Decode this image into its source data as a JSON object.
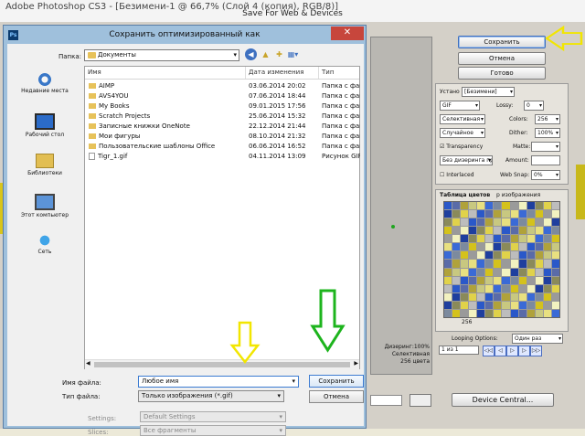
{
  "photoshop": {
    "title": "Adobe Photoshop CS3 - [Безимени-1 @ 66,7% (Слой 4 (копия), RGB/8)]",
    "sfw_title": "Save For Web & Devices"
  },
  "sfw": {
    "save_label": "Сохранить",
    "cancel_label": "Отмена",
    "done_label": "Готово",
    "preset_label": "Устано",
    "preset_value": "[Безимени]",
    "format": "GIF",
    "reduction": "Селективная",
    "dither_algo": "Случайное",
    "lossy_label": "Lossy:",
    "lossy_value": "0",
    "colors_label": "Colors:",
    "colors_value": "256",
    "dither_label": "Dither:",
    "dither_value": "100%",
    "transparency_label": "Transparency",
    "matte_label": "Matte:",
    "transp_dither": "Без дизеринга пр...",
    "amount_label": "Amount:",
    "interlaced_label": "Interlaced",
    "websnap_label": "Web Snap:",
    "websnap_value": "0%",
    "table_tab": "Таблица цветов",
    "image_tab": "р изображения",
    "color_count": "256",
    "looping_label": "Looping Options:",
    "looping_value": "Один раз",
    "frame_label": "1 из 1",
    "device_central": "Device Central...",
    "preview_info": [
      "Дизеринг:100%",
      "Селективная",
      "256 цвета"
    ]
  },
  "dialog": {
    "title": "Сохранить оптимизированный как",
    "folder_label": "Папка:",
    "folder_value": "Документы",
    "places": [
      {
        "label": "Недавние места",
        "icon": "recent-places-icon"
      },
      {
        "label": "Рабочий стол",
        "icon": "desktop-icon"
      },
      {
        "label": "Библиотеки",
        "icon": "libraries-icon"
      },
      {
        "label": "Этот компьютер",
        "icon": "computer-icon"
      },
      {
        "label": "Сеть",
        "icon": "network-icon"
      }
    ],
    "columns": {
      "name": "Имя",
      "date": "Дата изменения",
      "type": "Тип"
    },
    "files": [
      {
        "name": "AIMP",
        "date": "03.06.2014 20:02",
        "type": "Папка с файл",
        "kind": "folder"
      },
      {
        "name": "AVS4YOU",
        "date": "07.06.2014 18:44",
        "type": "Папка с файл",
        "kind": "folder"
      },
      {
        "name": "My Books",
        "date": "09.01.2015 17:56",
        "type": "Папка с файл",
        "kind": "folder"
      },
      {
        "name": "Scratch Projects",
        "date": "25.06.2014 15:32",
        "type": "Папка с файл",
        "kind": "folder"
      },
      {
        "name": "Записные книжки OneNote",
        "date": "22.12.2014 21:44",
        "type": "Папка с файл",
        "kind": "folder"
      },
      {
        "name": "Мои фигуры",
        "date": "08.10.2014 21:32",
        "type": "Папка с файл",
        "kind": "folder"
      },
      {
        "name": "Пользовательские шаблоны Office",
        "date": "06.06.2014 16:52",
        "type": "Папка с файл",
        "kind": "folder"
      },
      {
        "name": "Tigr_1.gif",
        "date": "04.11.2014 13:09",
        "type": "Рисунок GIF",
        "kind": "gif"
      }
    ],
    "filename_label": "Имя файла:",
    "filename_value": "Любое имя",
    "filetype_label": "Тип файла:",
    "filetype_value": "Только изображения (*.gif)",
    "save_label": "Сохранить",
    "cancel_label": "Отмена",
    "settings_label": "Settings:",
    "settings_value": "Default Settings",
    "slices_label": "Slices:",
    "slices_value": "Все фрагменты"
  },
  "colors": {
    "yellow_arrow": "#f2e600",
    "green_arrow": "#1db41d",
    "palette": [
      "#2a58c9",
      "#3a6ad6",
      "#1f3f9e",
      "#5a6ba8",
      "#7c8a9e",
      "#8a8a5a",
      "#b0a23a",
      "#d4c21c",
      "#e0d24a",
      "#c8c880",
      "#9a9a9a",
      "#bdbdbd",
      "#e8e080",
      "#f2f2c0"
    ]
  }
}
